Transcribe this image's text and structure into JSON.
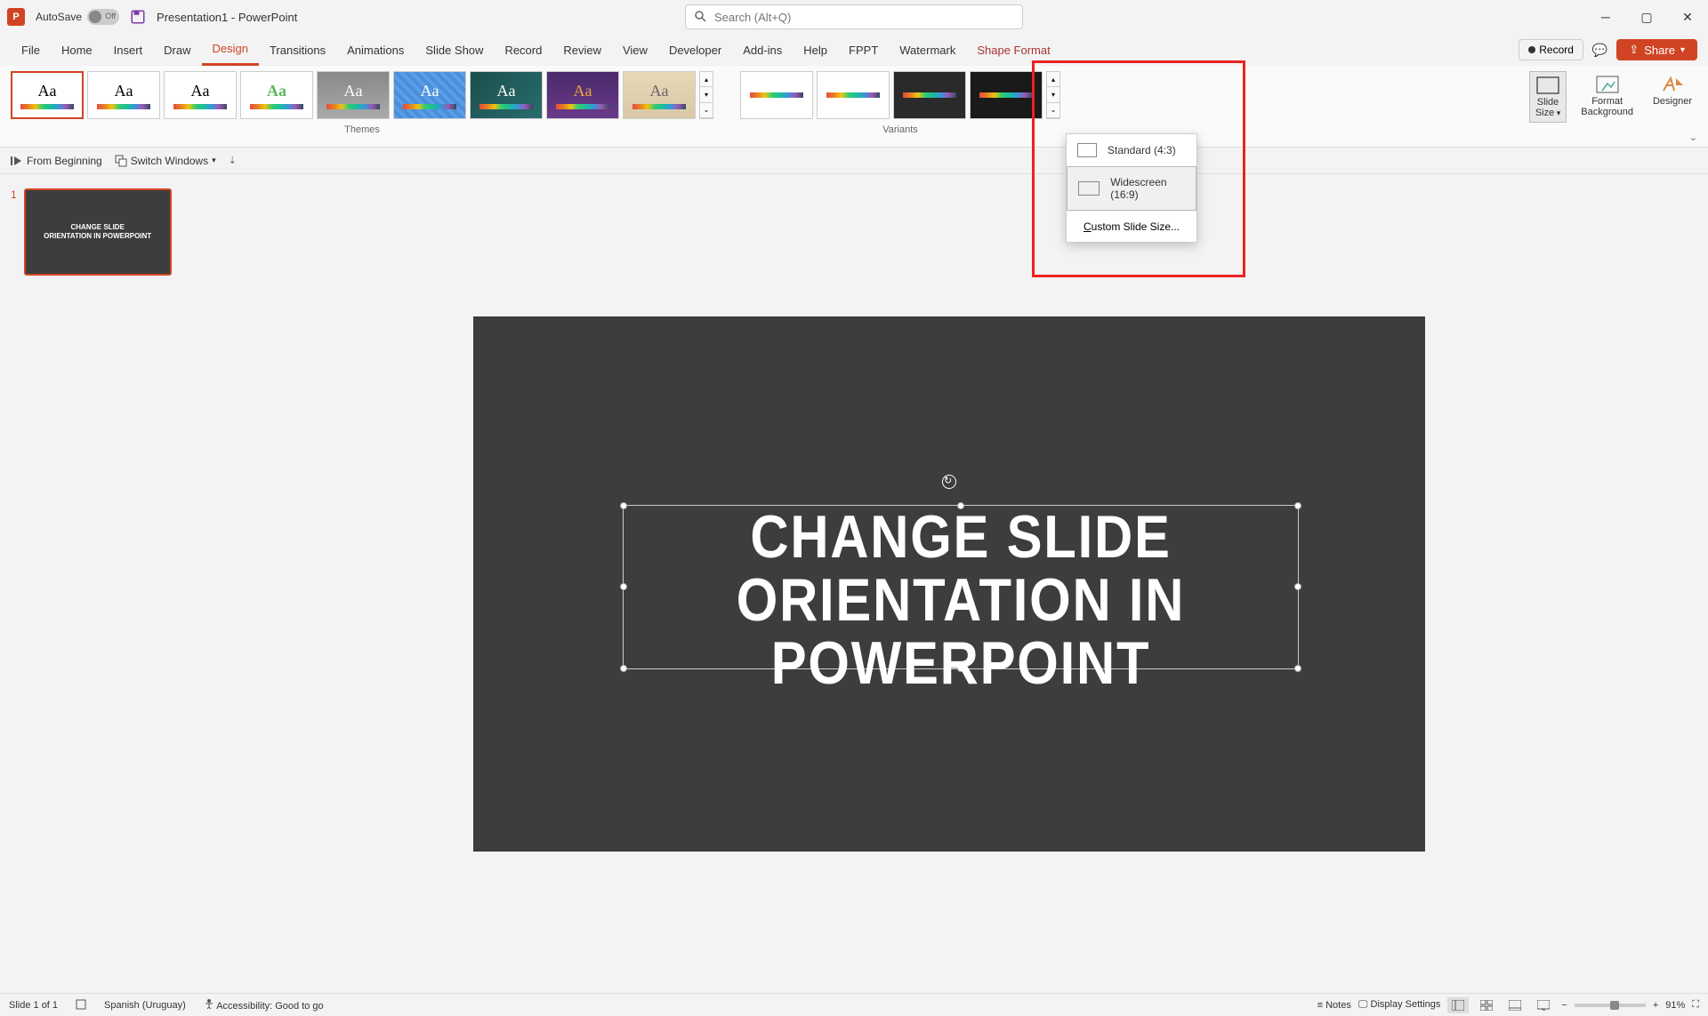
{
  "titlebar": {
    "autosave_label": "AutoSave",
    "autosave_state": "Off",
    "doc_title": "Presentation1 - PowerPoint",
    "search_placeholder": "Search (Alt+Q)"
  },
  "tabs": {
    "file": "File",
    "home": "Home",
    "insert": "Insert",
    "draw": "Draw",
    "design": "Design",
    "transitions": "Transitions",
    "animations": "Animations",
    "slideshow": "Slide Show",
    "record": "Record",
    "review": "Review",
    "view": "View",
    "developer": "Developer",
    "addins": "Add-ins",
    "help": "Help",
    "fppt": "FPPT",
    "watermark": "Watermark",
    "shape_format": "Shape Format"
  },
  "right_actions": {
    "record": "Record",
    "share": "Share"
  },
  "ribbon": {
    "themes_label": "Themes",
    "variants_label": "Variants",
    "slide_size": "Slide\nSize",
    "format_bg": "Format\nBackground",
    "designer": "Designer",
    "designer_label_trunc": "er"
  },
  "dropdown": {
    "standard": "Standard (4:3)",
    "widescreen": "Widescreen (16:9)",
    "custom": "Custom Slide Size..."
  },
  "qa": {
    "from_beginning": "From Beginning",
    "switch_windows": "Switch Windows"
  },
  "slide": {
    "number": "1",
    "line1": "CHANGE SLIDE",
    "line2": "ORIENTATION IN POWERPOINT",
    "thumb_line1": "CHANGE SLIDE",
    "thumb_line2": "ORIENTATION IN POWERPOINT"
  },
  "status": {
    "slide_count": "Slide 1 of 1",
    "language": "Spanish (Uruguay)",
    "accessibility": "Accessibility: Good to go",
    "notes": "Notes",
    "display_settings": "Display Settings",
    "zoom": "91%"
  }
}
